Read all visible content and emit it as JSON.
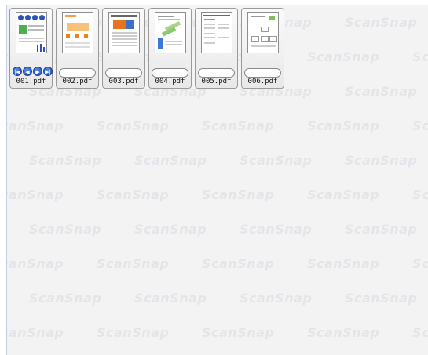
{
  "watermark": {
    "text": "ScanSnap"
  },
  "thumbnails": [
    {
      "filename": "001.pdf",
      "selected": true
    },
    {
      "filename": "002.pdf"
    },
    {
      "filename": "003.pdf"
    },
    {
      "filename": "004.pdf"
    },
    {
      "filename": "005.pdf"
    },
    {
      "filename": "006.pdf"
    }
  ],
  "page_navigator": {
    "first_icon": "skip-first-icon",
    "prev_icon": "prev-page-icon",
    "next_icon": "next-page-icon",
    "last_icon": "skip-last-icon"
  },
  "colors": {
    "nav_blue": "#1d4fb4",
    "watermark": "#e4e5e8",
    "background": "#f3f3f4"
  }
}
